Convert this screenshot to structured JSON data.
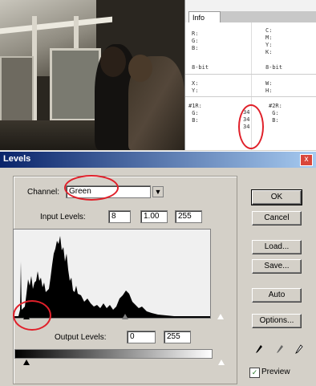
{
  "info_panel": {
    "tab_label": "Info",
    "rows": [
      [
        "R:\nG:\nB:",
        "C:\nM:\nY:\nK:"
      ],
      [
        "8-bit",
        "8-bit"
      ],
      [
        "X:\nY:",
        "W:\nH:"
      ],
      [
        "#1R:\n G:\n B:",
        "34\n34\n34",
        "#2R:\n G:\n B:"
      ]
    ]
  },
  "dialog": {
    "title": "Levels",
    "close_label": "x",
    "channel_label": "Channel:",
    "channel_value": "Green",
    "input_levels_label": "Input Levels:",
    "input_levels": [
      "8",
      "1.00",
      "255"
    ],
    "output_levels_label": "Output Levels:",
    "output_levels": [
      "0",
      "255"
    ],
    "buttons": {
      "ok": "OK",
      "cancel": "Cancel",
      "load": "Load...",
      "save": "Save...",
      "auto": "Auto",
      "options": "Options..."
    },
    "preview_label": "Preview",
    "preview_checked": true
  },
  "colors": {
    "annotation": "#e0202a",
    "titlebar_start": "#0a246a",
    "titlebar_end": "#a6caf0"
  }
}
